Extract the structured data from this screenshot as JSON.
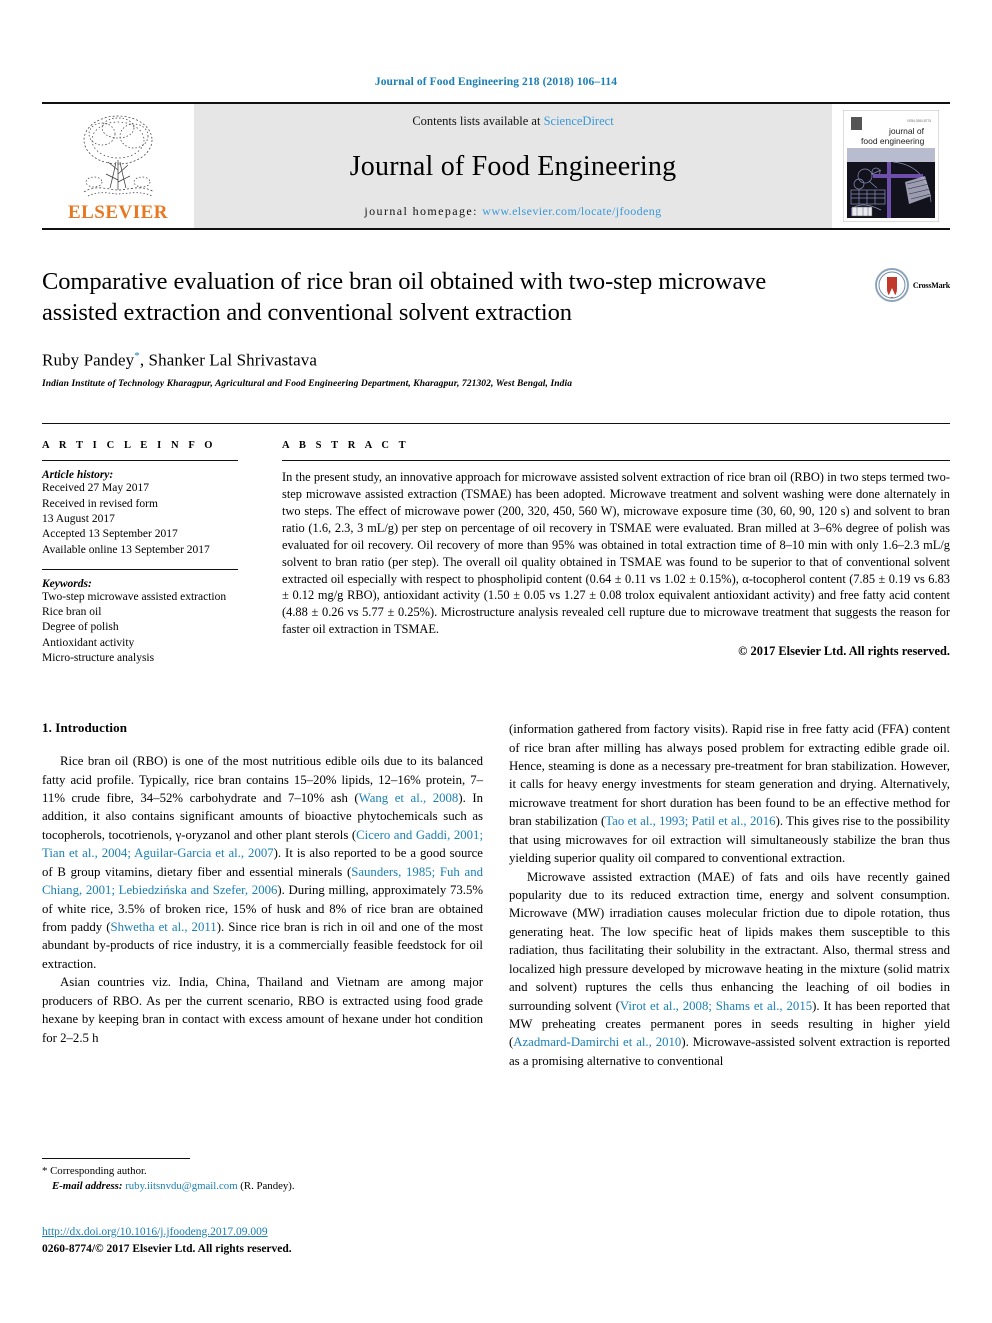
{
  "running_head": "Journal of Food Engineering 218 (2018) 106–114",
  "masthead": {
    "publisher_name": "ELSEVIER",
    "contents_prefix": "Contents lists available at ",
    "contents_link": "ScienceDirect",
    "journal_title": "Journal of Food Engineering",
    "homepage_prefix": "journal homepage: ",
    "homepage_url": "www.elsevier.com/locate/jfoodeng",
    "cover_line1": "journal of",
    "cover_line2": "food engineering"
  },
  "article": {
    "title": "Comparative evaluation of rice bran oil obtained with two-step microwave assisted extraction and conventional solvent extraction",
    "authors": "Ruby Pandey",
    "authors_rest": ", Shanker Lal Shrivastava",
    "corresponding_marker": "*",
    "affiliation": "Indian Institute of Technology Kharagpur, Agricultural and Food Engineering Department, Kharagpur, 721302, West Bengal, India",
    "crossmark_label": "CrossMark"
  },
  "article_info": {
    "heading": "A R T I C L E  I N F O",
    "history_label": "Article history:",
    "history": [
      "Received 27 May 2017",
      "Received in revised form",
      "13 August 2017",
      "Accepted 13 September 2017",
      "Available online 13 September 2017"
    ],
    "keywords_label": "Keywords:",
    "keywords": [
      "Two-step microwave assisted extraction",
      "Rice bran oil",
      "Degree of polish",
      "Antioxidant activity",
      "Micro-structure analysis"
    ]
  },
  "abstract": {
    "heading": "A B S T R A C T",
    "text": "In the present study, an innovative approach for microwave assisted solvent extraction of rice bran oil (RBO) in two steps termed two-step microwave assisted extraction (TSMAE) has been adopted. Microwave treatment and solvent washing were done alternately in two steps. The effect of microwave power (200, 320, 450, 560 W), microwave exposure time (30, 60, 90, 120 s) and solvent to bran ratio (1.6, 2.3, 3 mL/g) per step on percentage of oil recovery in TSMAE were evaluated. Bran milled at 3–6% degree of polish was evaluated for oil recovery. Oil recovery of more than 95% was obtained in total extraction time of 8–10 min with only 1.6–2.3 mL/g solvent to bran ratio (per step). The overall oil quality obtained in TSMAE was found to be superior to that of conventional solvent extracted oil especially with respect to phospholipid content (0.64 ± 0.11 vs 1.02 ± 0.15%), α-tocopherol content (7.85 ± 0.19 vs 6.83 ± 0.12 mg/g RBO), antioxidant activity (1.50 ± 0.05 vs 1.27 ± 0.08 trolox equivalent antioxidant activity) and free fatty acid content (4.88 ± 0.26 vs 5.77 ± 0.25%). Microstructure analysis revealed cell rupture due to microwave treatment that suggests the reason for faster oil extraction in TSMAE.",
    "copyright": "© 2017 Elsevier Ltd. All rights reserved."
  },
  "body": {
    "section_heading": "1. Introduction",
    "left_paragraphs": [
      {
        "runs": [
          {
            "t": "Rice bran oil (RBO) is one of the most nutritious edible oils due to its balanced fatty acid profile. Typically, rice bran contains 15–20% lipids, 12–16% protein, 7–11% crude fibre, 34–52% carbohydrate and 7–10% ash ("
          },
          {
            "t": "Wang et al., 2008",
            "link": true
          },
          {
            "t": "). In addition, it also contains significant amounts of bioactive phytochemicals such as tocopherols, tocotrienols, γ-oryzanol and other plant sterols ("
          },
          {
            "t": "Cicero and Gaddi, 2001; Tian et al., 2004; Aguilar-Garcia et al., 2007",
            "link": true
          },
          {
            "t": "). It is also reported to be a good source of B group vitamins, dietary fiber and essential minerals ("
          },
          {
            "t": "Saunders, 1985; Fuh and Chiang, 2001; Lebiedzińska and Szefer, 2006",
            "link": true
          },
          {
            "t": "). During milling, approximately 73.5% of white rice, 3.5% of broken rice, 15% of husk and 8% of rice bran are obtained from paddy ("
          },
          {
            "t": "Shwetha et al., 2011",
            "link": true
          },
          {
            "t": "). Since rice bran is rich in oil and one of the most abundant by-products of rice industry, it is a commercially feasible feedstock for oil extraction."
          }
        ]
      },
      {
        "runs": [
          {
            "t": "Asian countries viz. India, China, Thailand and Vietnam are among major producers of RBO. As per the current scenario, RBO is extracted using food grade hexane by keeping bran in contact with excess amount of hexane under hot condition for 2–2.5 h"
          }
        ]
      }
    ],
    "right_paragraphs": [
      {
        "indent": false,
        "runs": [
          {
            "t": "(information gathered from factory visits). Rapid rise in free fatty acid (FFA) content of rice bran after milling has always posed problem for extracting edible grade oil. Hence, steaming is done as a necessary pre-treatment for bran stabilization. However, it calls for heavy energy investments for steam generation and drying. Alternatively, microwave treatment for short duration has been found to be an effective method for bran stabilization ("
          },
          {
            "t": "Tao et al., 1993; Patil et al., 2016",
            "link": true
          },
          {
            "t": "). This gives rise to the possibility that using microwaves for oil extraction will simultaneously stabilize the bran thus yielding superior quality oil compared to conventional extraction."
          }
        ]
      },
      {
        "indent": true,
        "runs": [
          {
            "t": "Microwave assisted extraction (MAE) of fats and oils have recently gained popularity due to its reduced extraction time, energy and solvent consumption. Microwave (MW) irradiation causes molecular friction due to dipole rotation, thus generating heat. The low specific heat of lipids makes them susceptible to this radiation, thus facilitating their solubility in the extractant. Also, thermal stress and localized high pressure developed by microwave heating in the mixture (solid matrix and solvent) ruptures the cells thus enhancing the leaching of oil bodies in surrounding solvent ("
          },
          {
            "t": "Virot et al., 2008; Shams et al., 2015",
            "link": true
          },
          {
            "t": "). It has been reported that MW preheating creates permanent pores in seeds resulting in higher yield ("
          },
          {
            "t": "Azadmard-Damirchi et al., 2010",
            "link": true
          },
          {
            "t": "). Microwave-assisted solvent extraction is reported as a promising alternative to conventional"
          }
        ]
      }
    ]
  },
  "footer": {
    "corresponding_marker": "*",
    "corresponding_label": "Corresponding author.",
    "email_label": "E-mail address:",
    "email": "ruby.iitsnvdu@gmail.com",
    "email_suffix": "(R. Pandey).",
    "doi": "http://dx.doi.org/10.1016/j.jfoodeng.2017.09.009",
    "issn_line": "0260-8774/© 2017 Elsevier Ltd. All rights reserved."
  },
  "colors": {
    "link": "#1a7fb5",
    "sciencedirect": "#3a9ad9",
    "elsevier_orange": "#e87722",
    "masthead_bg": "#e6e6e6"
  }
}
